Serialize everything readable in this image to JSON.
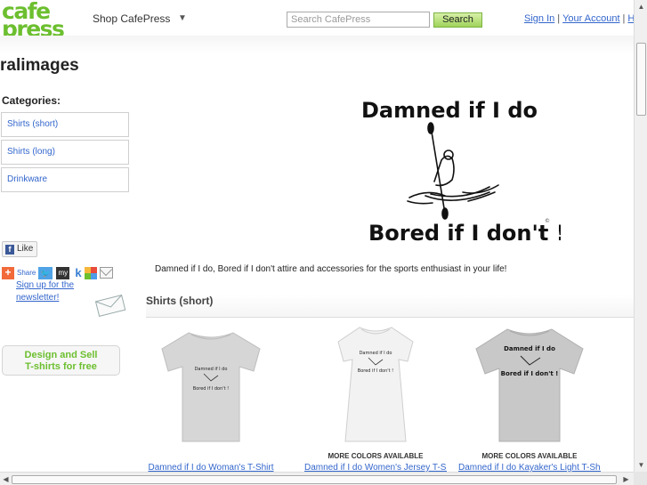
{
  "header": {
    "logo_line1": "cafe",
    "logo_line2": "press",
    "shop_menu": "Shop CafePress",
    "search_placeholder": "Search CafePress",
    "search_button": "Search",
    "sign_in": "Sign In",
    "separator": "|",
    "your_account": "Your Account",
    "help": "He"
  },
  "store": {
    "title": "ralimages"
  },
  "sidebar": {
    "categories_heading": "Categories:",
    "categories": [
      "Shirts (short)",
      "Shirts (long)",
      "Drinkware"
    ],
    "like_label": "Like",
    "share_label": "Share",
    "share_icons": [
      "twitter-icon",
      "myspace-icon",
      "kaboodle-icon",
      "google-icon",
      "email-icon"
    ],
    "myspace_text": "my",
    "kaboodle_text": "k",
    "newsletter": "Sign up for the newsletter!",
    "design_sell_line1": "Design and Sell",
    "design_sell_line2": "T-shirts for free"
  },
  "banner": {
    "line1": "Damned if I do",
    "line2": "Bored if I don't !"
  },
  "main": {
    "tagline": "Damned if I do, Bored if I don't attire and accessories for the sports enthusiast in your life!",
    "section_title": "Shirts (short)",
    "products": [
      {
        "name": "Damned if I do Woman's T-Shirt",
        "colors": "",
        "shirt_color": "#d6d6d6",
        "print_line1": "Damned if I do",
        "print_line2": "Bored if I don't !"
      },
      {
        "name": "Damned if I do Women's Jersey T-Shirt",
        "colors": "MORE COLORS AVAILABLE",
        "shirt_color": "#f2f2f2",
        "print_line1": "Damned if I do",
        "print_line2": "Bored if I don't !"
      },
      {
        "name": "Damned if I do Kayaker's Light T-Shirt",
        "colors": "MORE COLORS AVAILABLE",
        "shirt_color": "#c8c8c8",
        "print_line1": "Damned if I do",
        "print_line2": "Bored if I don't !"
      }
    ]
  },
  "colors": {
    "brand_green": "#6cbf2f",
    "link_blue": "#3366cc"
  }
}
